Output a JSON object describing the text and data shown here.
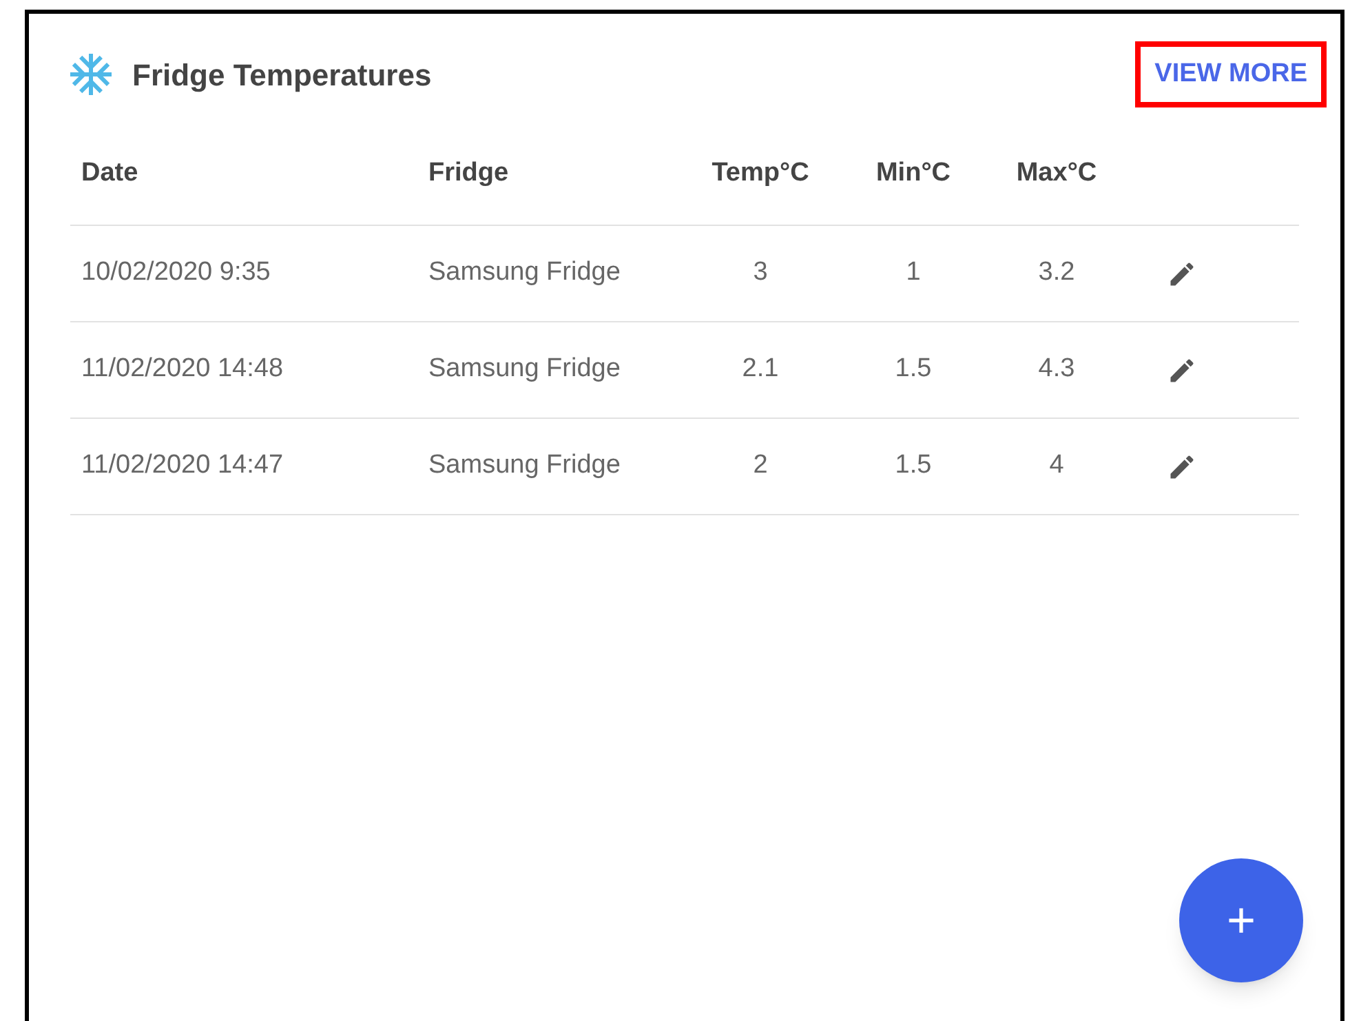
{
  "card": {
    "title": "Fridge Temperatures",
    "view_more": {
      "label": "VIEW MORE",
      "highlighted": true
    }
  },
  "table": {
    "columns": [
      "Date",
      "Fridge",
      "Temp°C",
      "Min°C",
      "Max°C"
    ],
    "rows": [
      {
        "date": "10/02/2020 9:35",
        "fridge": "Samsung Fridge",
        "temp": "3",
        "min": "1",
        "max": "3.2"
      },
      {
        "date": "11/02/2020 14:48",
        "fridge": "Samsung Fridge",
        "temp": "2.1",
        "min": "1.5",
        "max": "4.3"
      },
      {
        "date": "11/02/2020 14:47",
        "fridge": "Samsung Fridge",
        "temp": "2",
        "min": "1.5",
        "max": "4"
      }
    ]
  },
  "fab": {
    "label": "+"
  }
}
